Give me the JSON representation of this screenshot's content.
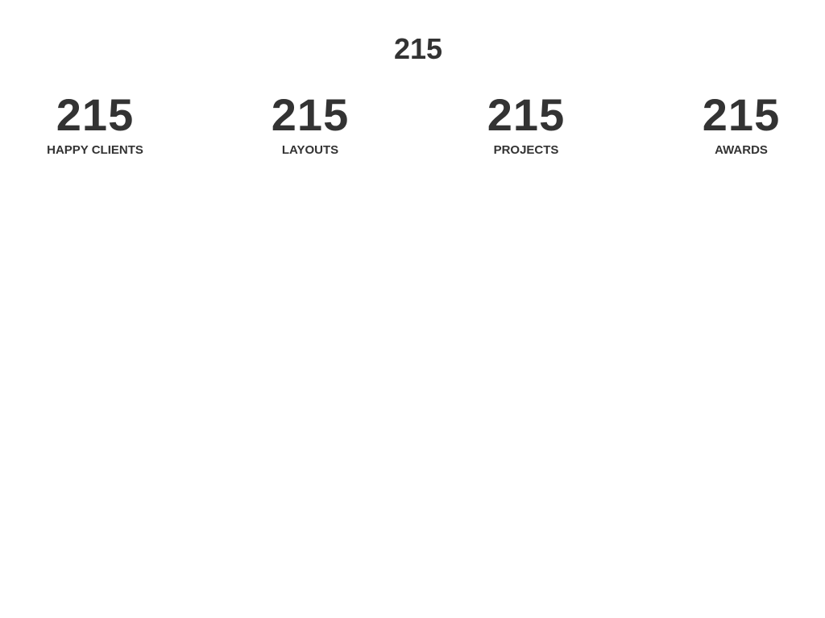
{
  "top_counter": {
    "value": "215"
  },
  "stats": [
    {
      "value": "215",
      "label": "HAPPY CLIENTS"
    },
    {
      "value": "215",
      "label": "LAYOUTS"
    },
    {
      "value": "215",
      "label": "PROJECTS"
    },
    {
      "value": "215",
      "label": "AWARDS"
    }
  ],
  "colors": {
    "background": "#ffffff",
    "text": "#333333"
  }
}
